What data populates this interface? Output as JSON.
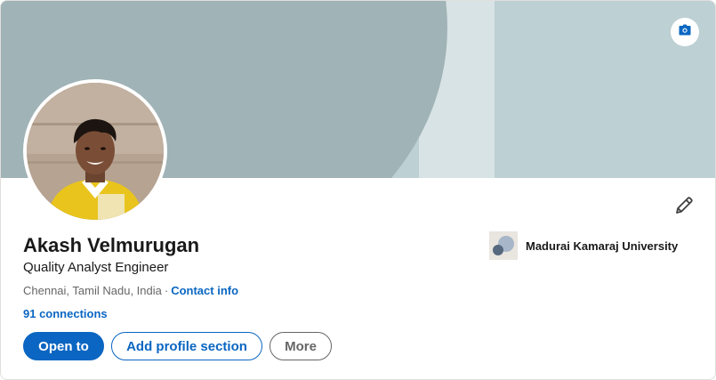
{
  "profile": {
    "name": "Akash Velmurugan",
    "headline": "Quality Analyst Engineer",
    "location": "Chennai, Tamil Nadu, India",
    "separator": "·",
    "contact_info_label": "Contact info",
    "connections_label": "91 connections"
  },
  "education": {
    "school_name": "Madurai Kamaraj University"
  },
  "actions": {
    "open_to_label": "Open to",
    "add_section_label": "Add profile section",
    "more_label": "More"
  },
  "icons": {
    "banner_edit": "camera-icon",
    "intro_edit": "pencil-icon"
  },
  "colors": {
    "brand_blue": "#0a66c2",
    "banner_light": "#bdd0d3",
    "banner_dark": "#a0b3b7",
    "text_primary": "#191919",
    "text_secondary": "#666666"
  }
}
